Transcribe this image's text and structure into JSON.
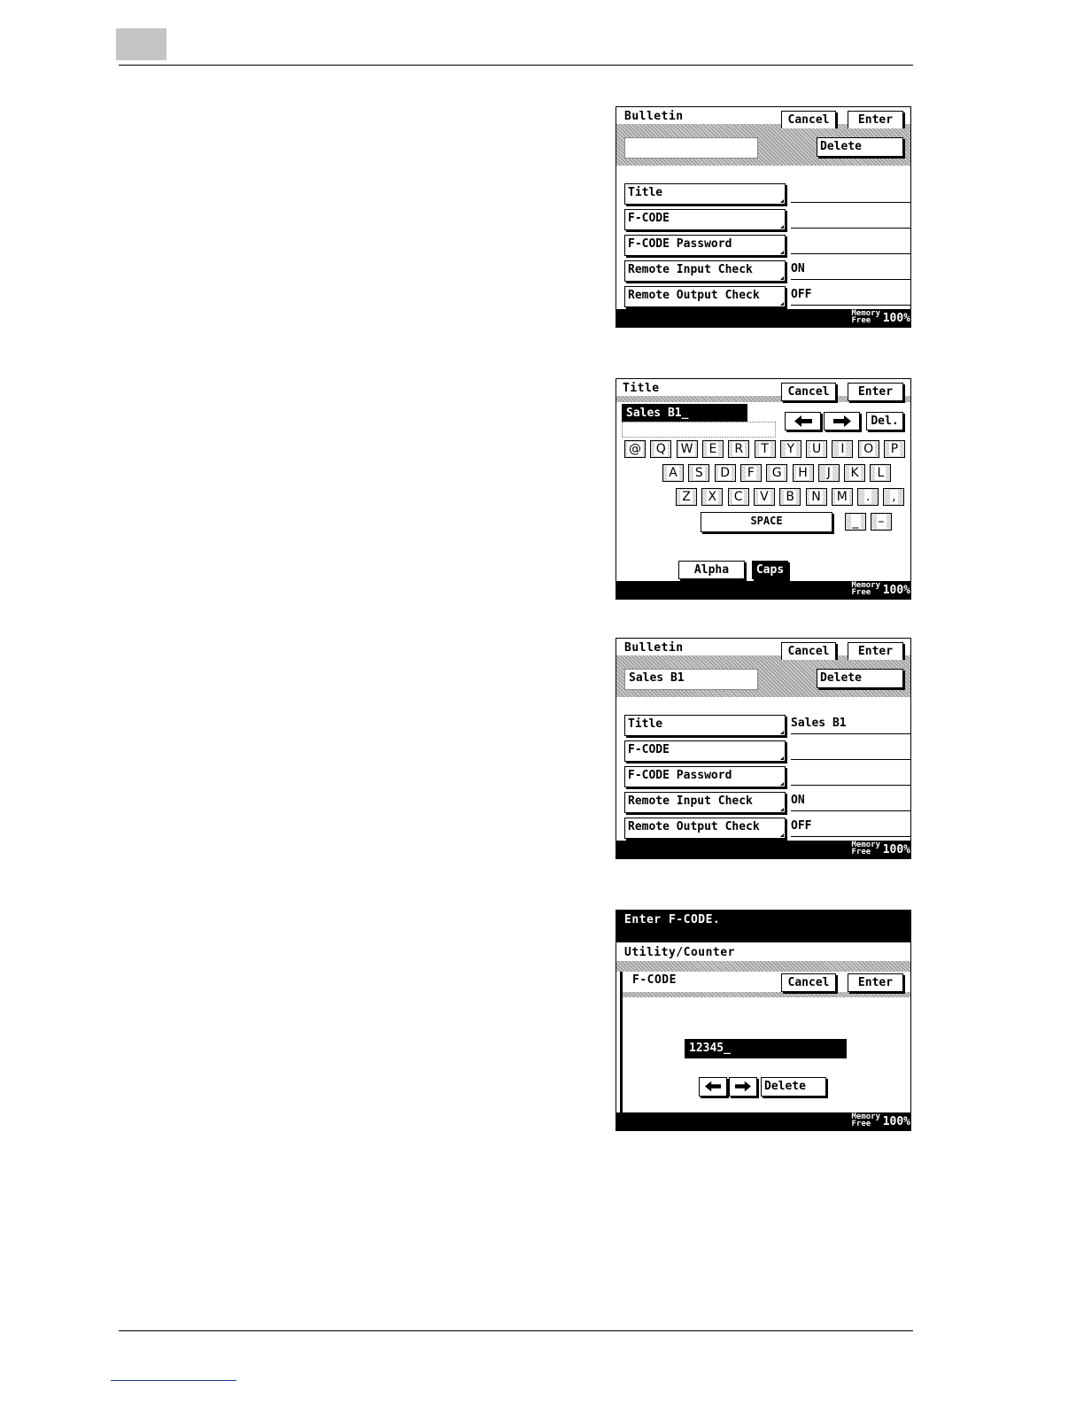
{
  "memory": {
    "label_line1": "Memory",
    "label_line2": "Free",
    "value": "100%"
  },
  "screen1": {
    "title": "Bulletin",
    "cancel_label": "Cancel",
    "enter_label": "Enter",
    "delete_label": "Delete",
    "name_field": "",
    "rows": [
      {
        "label": "Title",
        "value": ""
      },
      {
        "label": "F-CODE",
        "value": ""
      },
      {
        "label": "F-CODE Password",
        "value": ""
      },
      {
        "label": "Remote Input Check",
        "value": "ON"
      },
      {
        "label": "Remote Output Check",
        "value": "OFF"
      }
    ]
  },
  "screen2": {
    "title": "Title",
    "cancel_label": "Cancel",
    "enter_label": "Enter",
    "input_value": "Sales B1_",
    "del_label": "Del.",
    "left_arrow_icon": "arrow-left-icon",
    "right_arrow_icon": "arrow-right-icon",
    "row1": [
      "@",
      "Q",
      "W",
      "E",
      "R",
      "T",
      "Y",
      "U",
      "I",
      "O",
      "P"
    ],
    "row2": [
      "A",
      "S",
      "D",
      "F",
      "G",
      "H",
      "J",
      "K",
      "L"
    ],
    "row3": [
      "Z",
      "X",
      "C",
      "V",
      "B",
      "N",
      "M",
      ".",
      ","
    ],
    "space_label": "SPACE",
    "underscore_label": "_",
    "hyphen_label": "–",
    "alpha_label": "Alpha",
    "caps_label": "Caps"
  },
  "screen3": {
    "title": "Bulletin",
    "cancel_label": "Cancel",
    "enter_label": "Enter",
    "delete_label": "Delete",
    "name_field": "Sales B1",
    "rows": [
      {
        "label": "Title",
        "value": "Sales B1"
      },
      {
        "label": "F-CODE",
        "value": ""
      },
      {
        "label": "F-CODE Password",
        "value": ""
      },
      {
        "label": "Remote Input Check",
        "value": "ON"
      },
      {
        "label": "Remote Output Check",
        "value": "OFF"
      }
    ]
  },
  "screen4": {
    "prompt": "Enter F-CODE.",
    "breadcrumb": "Utility/Counter",
    "title": "F-CODE",
    "cancel_label": "Cancel",
    "enter_label": "Enter",
    "input_value": "12345_",
    "delete_label": "Delete"
  }
}
